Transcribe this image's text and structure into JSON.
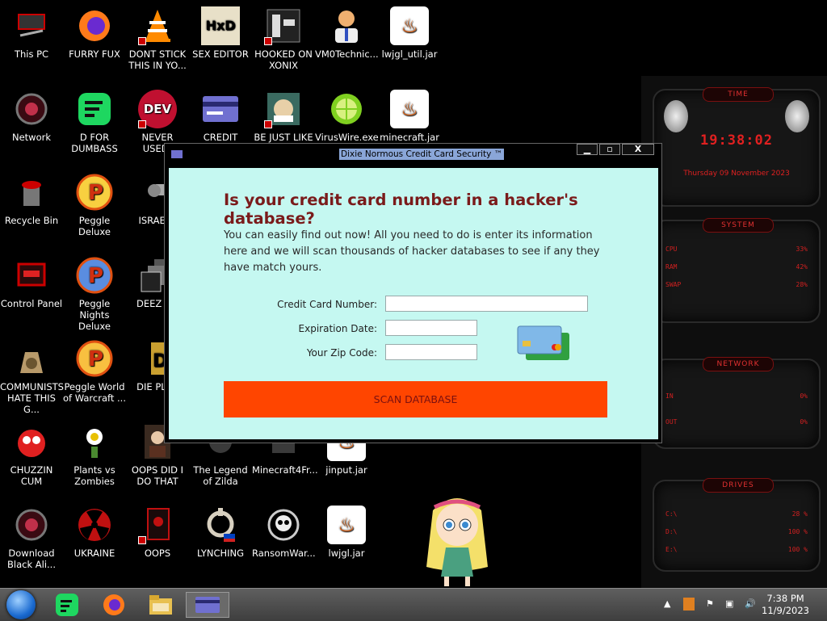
{
  "desktop": {
    "icons": [
      {
        "label": "This PC"
      },
      {
        "label": "FURRY FUX"
      },
      {
        "label": "DONT STICK THIS IN YO..."
      },
      {
        "label": "SEX EDITOR"
      },
      {
        "label": "HOOKED ON XONIX"
      },
      {
        "label": "VM0Technic..."
      },
      {
        "label": "lwjgl_util.jar"
      },
      {
        "label": "Network"
      },
      {
        "label": "D FOR DUMBASS"
      },
      {
        "label": "NEVER USED!"
      },
      {
        "label": "CREDIT CARD CHECKER"
      },
      {
        "label": "BE JUST LIKE THE DUDE!"
      },
      {
        "label": "VirusWire.exe"
      },
      {
        "label": "minecraft.jar"
      },
      {
        "label": "Recycle Bin"
      },
      {
        "label": "Peggle Deluxe"
      },
      {
        "label": "ISRAELS"
      },
      {
        "label": "Control Panel"
      },
      {
        "label": "Peggle Nights Deluxe"
      },
      {
        "label": "DEEZ NU"
      },
      {
        "label": "COMMUNISTS HATE THIS G..."
      },
      {
        "label": "Peggle World of Warcraft ..."
      },
      {
        "label": "DIE PLEA"
      },
      {
        "label": "CHUZZIN CUM"
      },
      {
        "label": "Plants vs Zombies"
      },
      {
        "label": "OOPS DID I DO THAT"
      },
      {
        "label": "The Legend of Zilda"
      },
      {
        "label": "Minecraft4Fr..."
      },
      {
        "label": "jinput.jar"
      },
      {
        "label": "Download Black Ali..."
      },
      {
        "label": "UKRAINE"
      },
      {
        "label": "OOPS"
      },
      {
        "label": "LYNCHING"
      },
      {
        "label": "RansomWar..."
      },
      {
        "label": "lwjgl.jar"
      }
    ],
    "icon_glyphs": {
      "dev": "DEV",
      "java": "♨"
    }
  },
  "gadget": {
    "time_title": "TIME",
    "time": "19:38:02",
    "date": "Thursday 09 November 2023",
    "system_title": "SYSTEM",
    "cpu_label": "CPU",
    "cpu_value": "33%",
    "ram_label": "RAM",
    "ram_value": "42%",
    "swap_label": "SWAP",
    "swap_value": "28%",
    "network_title": "NETWORK",
    "in_label": "IN",
    "in_value": "0%",
    "out_label": "OUT",
    "out_value": "0%",
    "drives_title": "DRIVES",
    "drives": [
      {
        "label": "C:\\",
        "value": "28 %"
      },
      {
        "label": "D:\\",
        "value": "100 %"
      },
      {
        "label": "E:\\",
        "value": "100 %"
      }
    ]
  },
  "window": {
    "title": "Dixie Normous Credit Card Security ™",
    "minimize": "▁",
    "maximize": "▫",
    "close": "X",
    "heading": "Is your credit card number in a hacker's database?",
    "paragraph": "You can easily find out now! All you need to do is enter its information here and we will scan thousands of hacker databases to see if any they have match yours.",
    "card_label": "Credit Card Number:",
    "card_value": "",
    "exp_label": "Expiration Date:",
    "exp_value": "",
    "zip_label": "Your Zip Code:",
    "zip_value": "",
    "scan_label": "SCAN DATABASE"
  },
  "taskbar": {
    "time": "7:38 PM",
    "date": "11/9/2023"
  }
}
